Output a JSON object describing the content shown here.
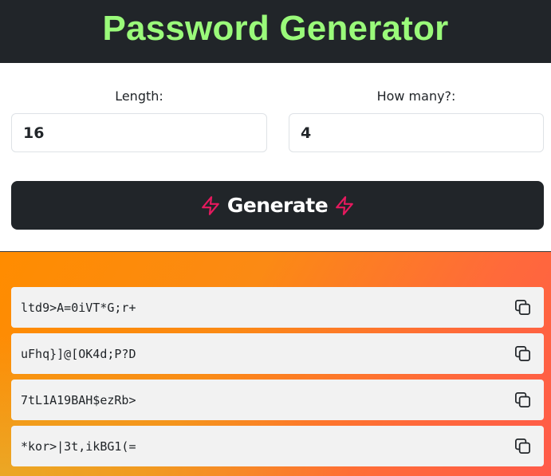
{
  "header": {
    "title": "Password Generator"
  },
  "form": {
    "length_label": "Length:",
    "length_value": "16",
    "count_label": "How many?:",
    "count_value": "4",
    "generate_label": "Generate"
  },
  "passwords": [
    "ltd9>A=0iVT*G;r+",
    "uFhq}]@[OK4d;P?D",
    "7tL1A19BAH$ezRb>",
    "*kor>|3t,ikBG1(="
  ],
  "icons": {
    "generate_left": "lightning-icon",
    "generate_right": "lightning-icon",
    "copy": "copy-icon"
  },
  "colors": {
    "header_bg": "#212529",
    "title": "#9afa7a",
    "bolt": "#e6195e",
    "gradient_start": "#ff8c00",
    "gradient_end": "#ff5a4a"
  }
}
